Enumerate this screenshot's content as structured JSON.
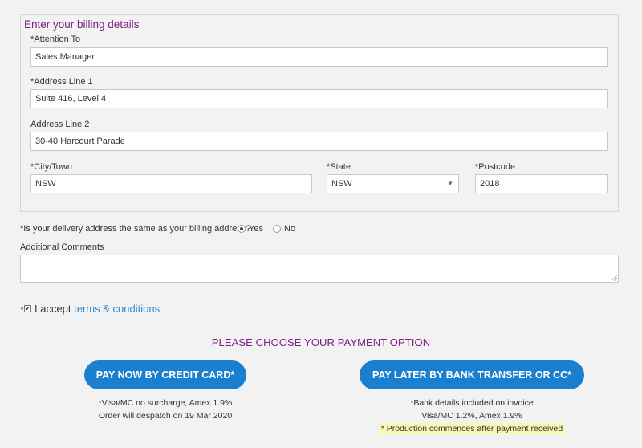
{
  "billing": {
    "title": "Enter your billing details",
    "attention_label": "*Attention To",
    "attention_value": "Sales Manager",
    "address1_label": "*Address Line 1",
    "address1_value": "Suite 416, Level 4",
    "address2_label": "Address Line 2",
    "address2_value": "30-40 Harcourt Parade",
    "city_label": "*City/Town",
    "city_value": "NSW",
    "state_label": "*State",
    "state_value": "NSW",
    "postcode_label": "*Postcode",
    "postcode_value": "2018"
  },
  "delivery": {
    "question": "*Is your delivery address the same as your billing address?",
    "yes_label": "Yes",
    "no_label": "No",
    "selected": "Yes"
  },
  "comments": {
    "label": "Additional Comments",
    "value": ""
  },
  "terms": {
    "required_mark": "*",
    "accept_text": "I accept ",
    "link_text": "terms & conditions",
    "checked": true
  },
  "payment": {
    "heading": "PLEASE CHOOSE YOUR PAYMENT OPTION",
    "credit_card": {
      "button_label": "PAY NOW BY CREDIT CARD*",
      "note_line1": "*Visa/MC no surcharge, Amex 1.9%",
      "note_line2": "Order will despatch on 19 Mar 2020"
    },
    "bank_transfer": {
      "button_label": "PAY LATER BY BANK TRANSFER OR CC*",
      "note_line1": "*Bank details included on invoice",
      "note_line2": "Visa/MC 1.2%, Amex 1.9%",
      "note_line3": "* Production commences after payment received"
    }
  },
  "colors": {
    "accent_purple": "#7b1e86",
    "button_blue": "#1a7fcf",
    "link_blue": "#2a8ad4",
    "highlight_yellow": "#fbf7b3"
  }
}
